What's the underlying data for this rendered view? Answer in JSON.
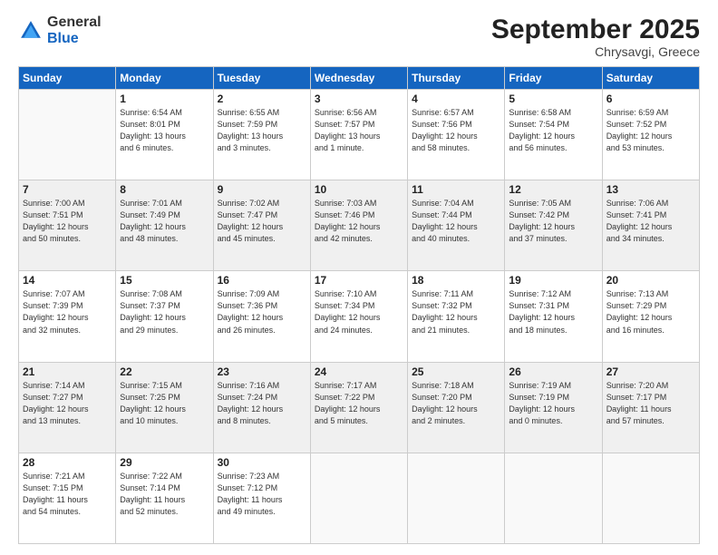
{
  "logo": {
    "line1": "General",
    "line2": "Blue"
  },
  "title": "September 2025",
  "location": "Chrysavgi, Greece",
  "days_header": [
    "Sunday",
    "Monday",
    "Tuesday",
    "Wednesday",
    "Thursday",
    "Friday",
    "Saturday"
  ],
  "weeks": [
    [
      {
        "day": "",
        "info": ""
      },
      {
        "day": "1",
        "info": "Sunrise: 6:54 AM\nSunset: 8:01 PM\nDaylight: 13 hours\nand 6 minutes."
      },
      {
        "day": "2",
        "info": "Sunrise: 6:55 AM\nSunset: 7:59 PM\nDaylight: 13 hours\nand 3 minutes."
      },
      {
        "day": "3",
        "info": "Sunrise: 6:56 AM\nSunset: 7:57 PM\nDaylight: 13 hours\nand 1 minute."
      },
      {
        "day": "4",
        "info": "Sunrise: 6:57 AM\nSunset: 7:56 PM\nDaylight: 12 hours\nand 58 minutes."
      },
      {
        "day": "5",
        "info": "Sunrise: 6:58 AM\nSunset: 7:54 PM\nDaylight: 12 hours\nand 56 minutes."
      },
      {
        "day": "6",
        "info": "Sunrise: 6:59 AM\nSunset: 7:52 PM\nDaylight: 12 hours\nand 53 minutes."
      }
    ],
    [
      {
        "day": "7",
        "info": "Sunrise: 7:00 AM\nSunset: 7:51 PM\nDaylight: 12 hours\nand 50 minutes."
      },
      {
        "day": "8",
        "info": "Sunrise: 7:01 AM\nSunset: 7:49 PM\nDaylight: 12 hours\nand 48 minutes."
      },
      {
        "day": "9",
        "info": "Sunrise: 7:02 AM\nSunset: 7:47 PM\nDaylight: 12 hours\nand 45 minutes."
      },
      {
        "day": "10",
        "info": "Sunrise: 7:03 AM\nSunset: 7:46 PM\nDaylight: 12 hours\nand 42 minutes."
      },
      {
        "day": "11",
        "info": "Sunrise: 7:04 AM\nSunset: 7:44 PM\nDaylight: 12 hours\nand 40 minutes."
      },
      {
        "day": "12",
        "info": "Sunrise: 7:05 AM\nSunset: 7:42 PM\nDaylight: 12 hours\nand 37 minutes."
      },
      {
        "day": "13",
        "info": "Sunrise: 7:06 AM\nSunset: 7:41 PM\nDaylight: 12 hours\nand 34 minutes."
      }
    ],
    [
      {
        "day": "14",
        "info": "Sunrise: 7:07 AM\nSunset: 7:39 PM\nDaylight: 12 hours\nand 32 minutes."
      },
      {
        "day": "15",
        "info": "Sunrise: 7:08 AM\nSunset: 7:37 PM\nDaylight: 12 hours\nand 29 minutes."
      },
      {
        "day": "16",
        "info": "Sunrise: 7:09 AM\nSunset: 7:36 PM\nDaylight: 12 hours\nand 26 minutes."
      },
      {
        "day": "17",
        "info": "Sunrise: 7:10 AM\nSunset: 7:34 PM\nDaylight: 12 hours\nand 24 minutes."
      },
      {
        "day": "18",
        "info": "Sunrise: 7:11 AM\nSunset: 7:32 PM\nDaylight: 12 hours\nand 21 minutes."
      },
      {
        "day": "19",
        "info": "Sunrise: 7:12 AM\nSunset: 7:31 PM\nDaylight: 12 hours\nand 18 minutes."
      },
      {
        "day": "20",
        "info": "Sunrise: 7:13 AM\nSunset: 7:29 PM\nDaylight: 12 hours\nand 16 minutes."
      }
    ],
    [
      {
        "day": "21",
        "info": "Sunrise: 7:14 AM\nSunset: 7:27 PM\nDaylight: 12 hours\nand 13 minutes."
      },
      {
        "day": "22",
        "info": "Sunrise: 7:15 AM\nSunset: 7:25 PM\nDaylight: 12 hours\nand 10 minutes."
      },
      {
        "day": "23",
        "info": "Sunrise: 7:16 AM\nSunset: 7:24 PM\nDaylight: 12 hours\nand 8 minutes."
      },
      {
        "day": "24",
        "info": "Sunrise: 7:17 AM\nSunset: 7:22 PM\nDaylight: 12 hours\nand 5 minutes."
      },
      {
        "day": "25",
        "info": "Sunrise: 7:18 AM\nSunset: 7:20 PM\nDaylight: 12 hours\nand 2 minutes."
      },
      {
        "day": "26",
        "info": "Sunrise: 7:19 AM\nSunset: 7:19 PM\nDaylight: 12 hours\nand 0 minutes."
      },
      {
        "day": "27",
        "info": "Sunrise: 7:20 AM\nSunset: 7:17 PM\nDaylight: 11 hours\nand 57 minutes."
      }
    ],
    [
      {
        "day": "28",
        "info": "Sunrise: 7:21 AM\nSunset: 7:15 PM\nDaylight: 11 hours\nand 54 minutes."
      },
      {
        "day": "29",
        "info": "Sunrise: 7:22 AM\nSunset: 7:14 PM\nDaylight: 11 hours\nand 52 minutes."
      },
      {
        "day": "30",
        "info": "Sunrise: 7:23 AM\nSunset: 7:12 PM\nDaylight: 11 hours\nand 49 minutes."
      },
      {
        "day": "",
        "info": ""
      },
      {
        "day": "",
        "info": ""
      },
      {
        "day": "",
        "info": ""
      },
      {
        "day": "",
        "info": ""
      }
    ]
  ]
}
